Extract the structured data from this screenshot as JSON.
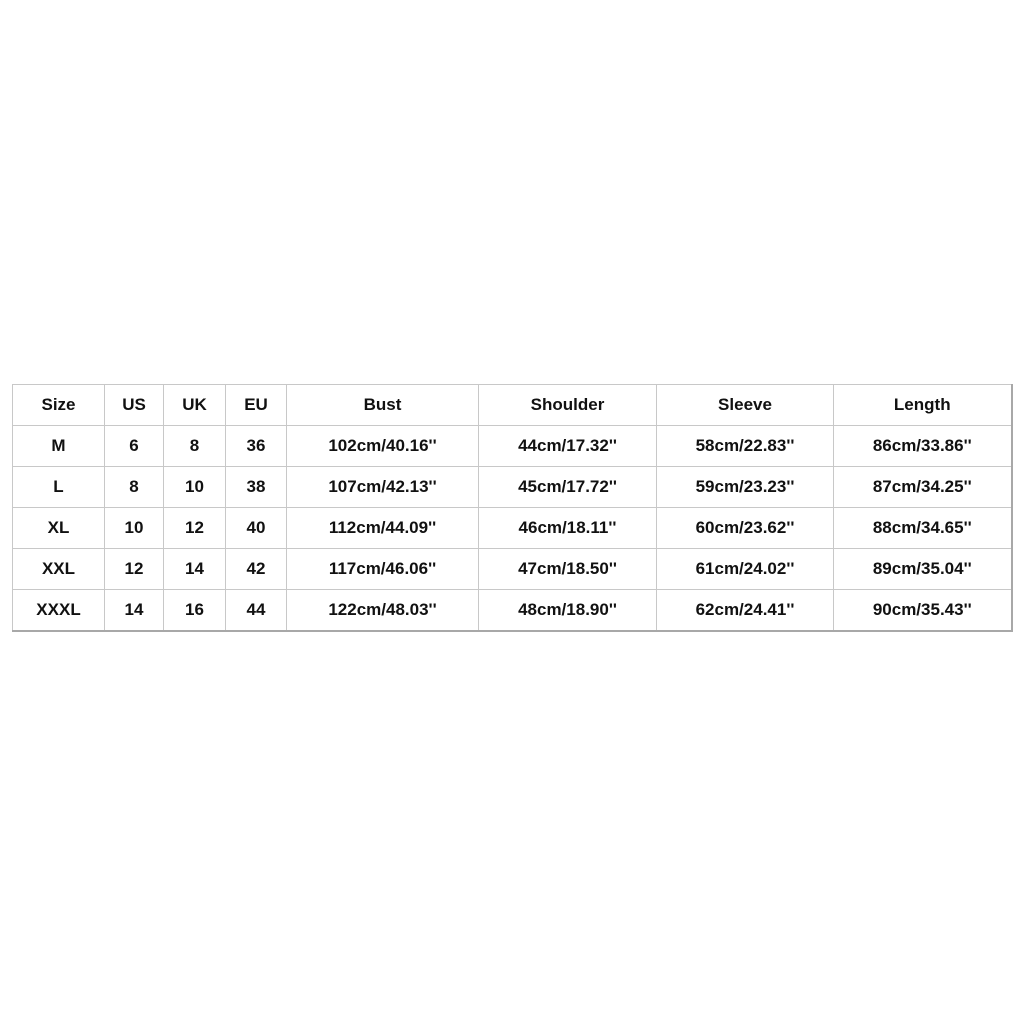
{
  "table": {
    "headers": [
      "Size",
      "US",
      "UK",
      "EU",
      "Bust",
      "Shoulder",
      "Sleeve",
      "Length"
    ],
    "rows": [
      [
        "M",
        "6",
        "8",
        "36",
        "102cm/40.16''",
        "44cm/17.32''",
        "58cm/22.83''",
        "86cm/33.86''"
      ],
      [
        "L",
        "8",
        "10",
        "38",
        "107cm/42.13''",
        "45cm/17.72''",
        "59cm/23.23''",
        "87cm/34.25''"
      ],
      [
        "XL",
        "10",
        "12",
        "40",
        "112cm/44.09''",
        "46cm/18.11''",
        "60cm/23.62''",
        "88cm/34.65''"
      ],
      [
        "XXL",
        "12",
        "14",
        "42",
        "117cm/46.06''",
        "47cm/18.50''",
        "61cm/24.02''",
        "89cm/35.04''"
      ],
      [
        "XXXL",
        "14",
        "16",
        "44",
        "122cm/48.03''",
        "48cm/18.90''",
        "62cm/24.41''",
        "90cm/35.43''"
      ]
    ]
  }
}
